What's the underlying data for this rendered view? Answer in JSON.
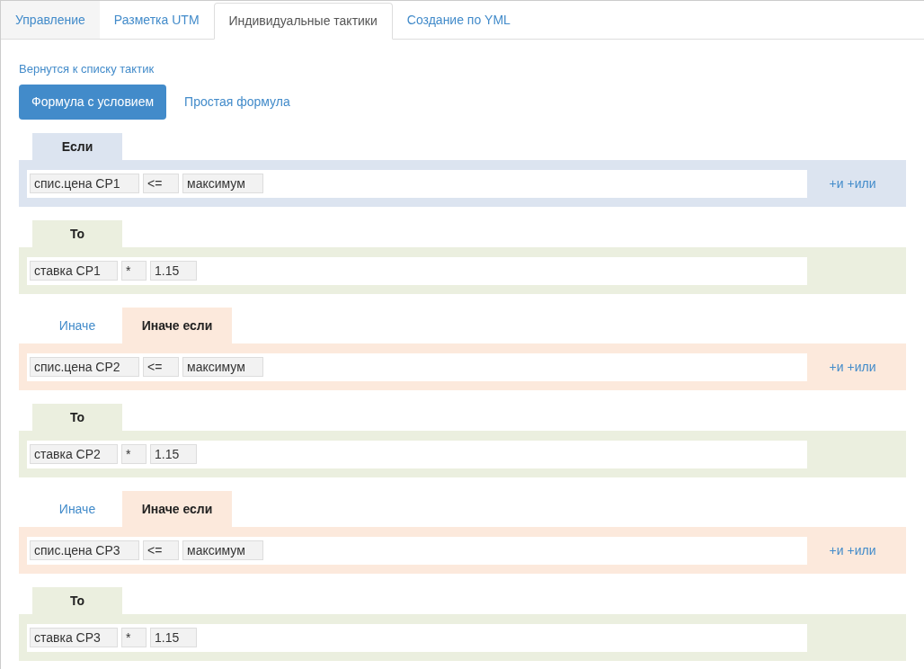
{
  "tabs": [
    {
      "label": "Управление",
      "selected": false,
      "kind": "muted"
    },
    {
      "label": "Разметка UTM",
      "selected": false,
      "kind": "plain"
    },
    {
      "label": "Индивидуальные тактики",
      "selected": true,
      "kind": "plain"
    },
    {
      "label": "Создание по YML",
      "selected": false,
      "kind": "plain"
    }
  ],
  "back_link": "Вернутся к списку тактик",
  "mode_buttons": [
    {
      "label": "Формула с условием",
      "selected": true
    },
    {
      "label": "Простая формула",
      "selected": false
    }
  ],
  "blocks": [
    {
      "kind": "if",
      "tabs": [
        {
          "label": "Если",
          "selected": true
        }
      ],
      "tokens": [
        "спис.цена СР1",
        "<=",
        "максимум"
      ],
      "links": [
        "+и",
        "+или"
      ]
    },
    {
      "kind": "then",
      "tabs": [
        {
          "label": "То",
          "selected": true
        }
      ],
      "tokens": [
        "ставка СР1",
        "*",
        "1.15"
      ]
    },
    {
      "kind": "elseif",
      "tabs": [
        {
          "label": "Иначе",
          "selected": false
        },
        {
          "label": "Иначе если",
          "selected": true
        }
      ],
      "tokens": [
        "спис.цена СР2",
        "<=",
        "максимум"
      ],
      "links": [
        "+и",
        "+или"
      ]
    },
    {
      "kind": "then",
      "tabs": [
        {
          "label": "То",
          "selected": true
        }
      ],
      "tokens": [
        "ставка СР2",
        "*",
        "1.15"
      ]
    },
    {
      "kind": "elseif",
      "tabs": [
        {
          "label": "Иначе",
          "selected": false
        },
        {
          "label": "Иначе если",
          "selected": true
        }
      ],
      "tokens": [
        "спис.цена СР3",
        "<=",
        "максимум"
      ],
      "links": [
        "+и",
        "+или"
      ]
    },
    {
      "kind": "then",
      "tabs": [
        {
          "label": "То",
          "selected": true
        }
      ],
      "tokens": [
        "ставка СР3",
        "*",
        "1.15"
      ]
    }
  ]
}
